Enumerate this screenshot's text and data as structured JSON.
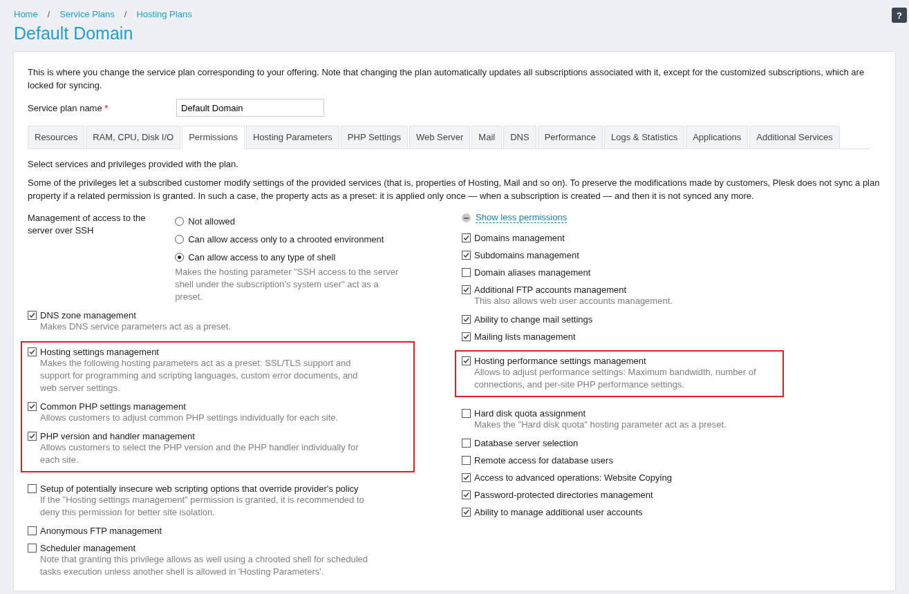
{
  "breadcrumbs": [
    "Home",
    "Service Plans",
    "Hosting Plans"
  ],
  "breadcrumb_separator": "/",
  "help_button": "?",
  "title": "Default Domain",
  "intro": "This is where you change the service plan corresponding to your offering. Note that changing the plan automatically updates all subscriptions associated with it, except for the customized subscriptions, which are locked for syncing.",
  "plan_name": {
    "label": "Service plan name",
    "required_mark": "*",
    "value": "Default Domain"
  },
  "tabs": [
    {
      "label": "Resources",
      "selected": false
    },
    {
      "label": "RAM, CPU, Disk I/O",
      "selected": false
    },
    {
      "label": "Permissions",
      "selected": true
    },
    {
      "label": "Hosting Parameters",
      "selected": false
    },
    {
      "label": "PHP Settings",
      "selected": false
    },
    {
      "label": "Web Server",
      "selected": false
    },
    {
      "label": "Mail",
      "selected": false
    },
    {
      "label": "DNS",
      "selected": false
    },
    {
      "label": "Performance",
      "selected": false
    },
    {
      "label": "Logs & Statistics",
      "selected": false
    },
    {
      "label": "Applications",
      "selected": false
    },
    {
      "label": "Additional Services",
      "selected": false
    }
  ],
  "lead": "Select services and privileges provided with the plan.",
  "note": "Some of the privileges let a subscribed customer modify settings of the provided services (that is, properties of Hosting, Mail and so on). To preserve the modifications made by customers, Plesk does not sync a plan property if a related permission is granted. In such a case, the property acts as a preset: it is applied only once — when a subscription is created — and then it is not synced any more.",
  "ssh": {
    "label": "Management of access to the server over SSH",
    "options": [
      {
        "label": "Not allowed",
        "selected": false
      },
      {
        "label": "Can allow access only to a chrooted environment",
        "selected": false
      },
      {
        "label": "Can allow access to any type of shell",
        "selected": true
      }
    ],
    "hint": "Makes the hosting parameter \"SSH access to the server shell under the subscription's system user\" act as a preset."
  },
  "left_groups": [
    {
      "highlighted": false,
      "items": [
        {
          "label": "DNS zone management",
          "checked": true,
          "hint": "Makes DNS service parameters act as a preset."
        }
      ]
    },
    {
      "highlighted": true,
      "items": [
        {
          "label": "Hosting settings management",
          "checked": true,
          "hint": "Makes the following hosting parameters act as a preset: SSL/TLS support and support for programming and scripting languages, custom error documents, and web server settings."
        },
        {
          "label": "Common PHP settings management",
          "checked": true,
          "hint": "Allows customers to adjust common PHP settings individually for each site."
        },
        {
          "label": "PHP version and handler management",
          "checked": true,
          "hint": "Allows customers to select the PHP version and the PHP handler individually for each site."
        }
      ]
    },
    {
      "highlighted": false,
      "items": [
        {
          "label": "Setup of potentially insecure web scripting options that override provider's policy",
          "checked": false,
          "hint": "If the \"Hosting settings management\" permission is granted, it is recommended to deny this permission for better site isolation."
        },
        {
          "label": "Anonymous FTP management",
          "checked": false
        },
        {
          "label": "Scheduler management",
          "checked": false,
          "hint": "Note that granting this privilege allows as well using a chrooted shell for scheduled tasks execution unless another shell is allowed in 'Hosting Parameters'."
        }
      ]
    }
  ],
  "toggle_link": "Show less permissions",
  "right_groups": [
    {
      "highlighted": false,
      "items": [
        {
          "label": "Domains management",
          "checked": true
        },
        {
          "label": "Subdomains management",
          "checked": true
        },
        {
          "label": "Domain aliases management",
          "checked": false
        },
        {
          "label": "Additional FTP accounts management",
          "checked": true,
          "hint": "This also allows web user accounts management."
        },
        {
          "label": "Ability to change mail settings",
          "checked": true
        },
        {
          "label": "Mailing lists management",
          "checked": true
        }
      ]
    },
    {
      "highlighted": true,
      "items": [
        {
          "label": "Hosting performance settings management",
          "checked": true,
          "hint": "Allows to adjust performance settings: Maximum bandwidth, number of connections, and per-site PHP performance settings."
        }
      ]
    },
    {
      "highlighted": false,
      "items": [
        {
          "label": "Hard disk quota assignment",
          "checked": false,
          "hint": "Makes the \"Hard disk quota\" hosting parameter act as a preset."
        },
        {
          "label": "Database server selection",
          "checked": false
        },
        {
          "label": "Remote access for database users",
          "checked": false
        },
        {
          "label": "Access to advanced operations: Website Copying",
          "checked": true
        },
        {
          "label": "Password-protected directories management",
          "checked": true
        },
        {
          "label": "Ability to manage additional user accounts",
          "checked": true
        }
      ]
    }
  ]
}
